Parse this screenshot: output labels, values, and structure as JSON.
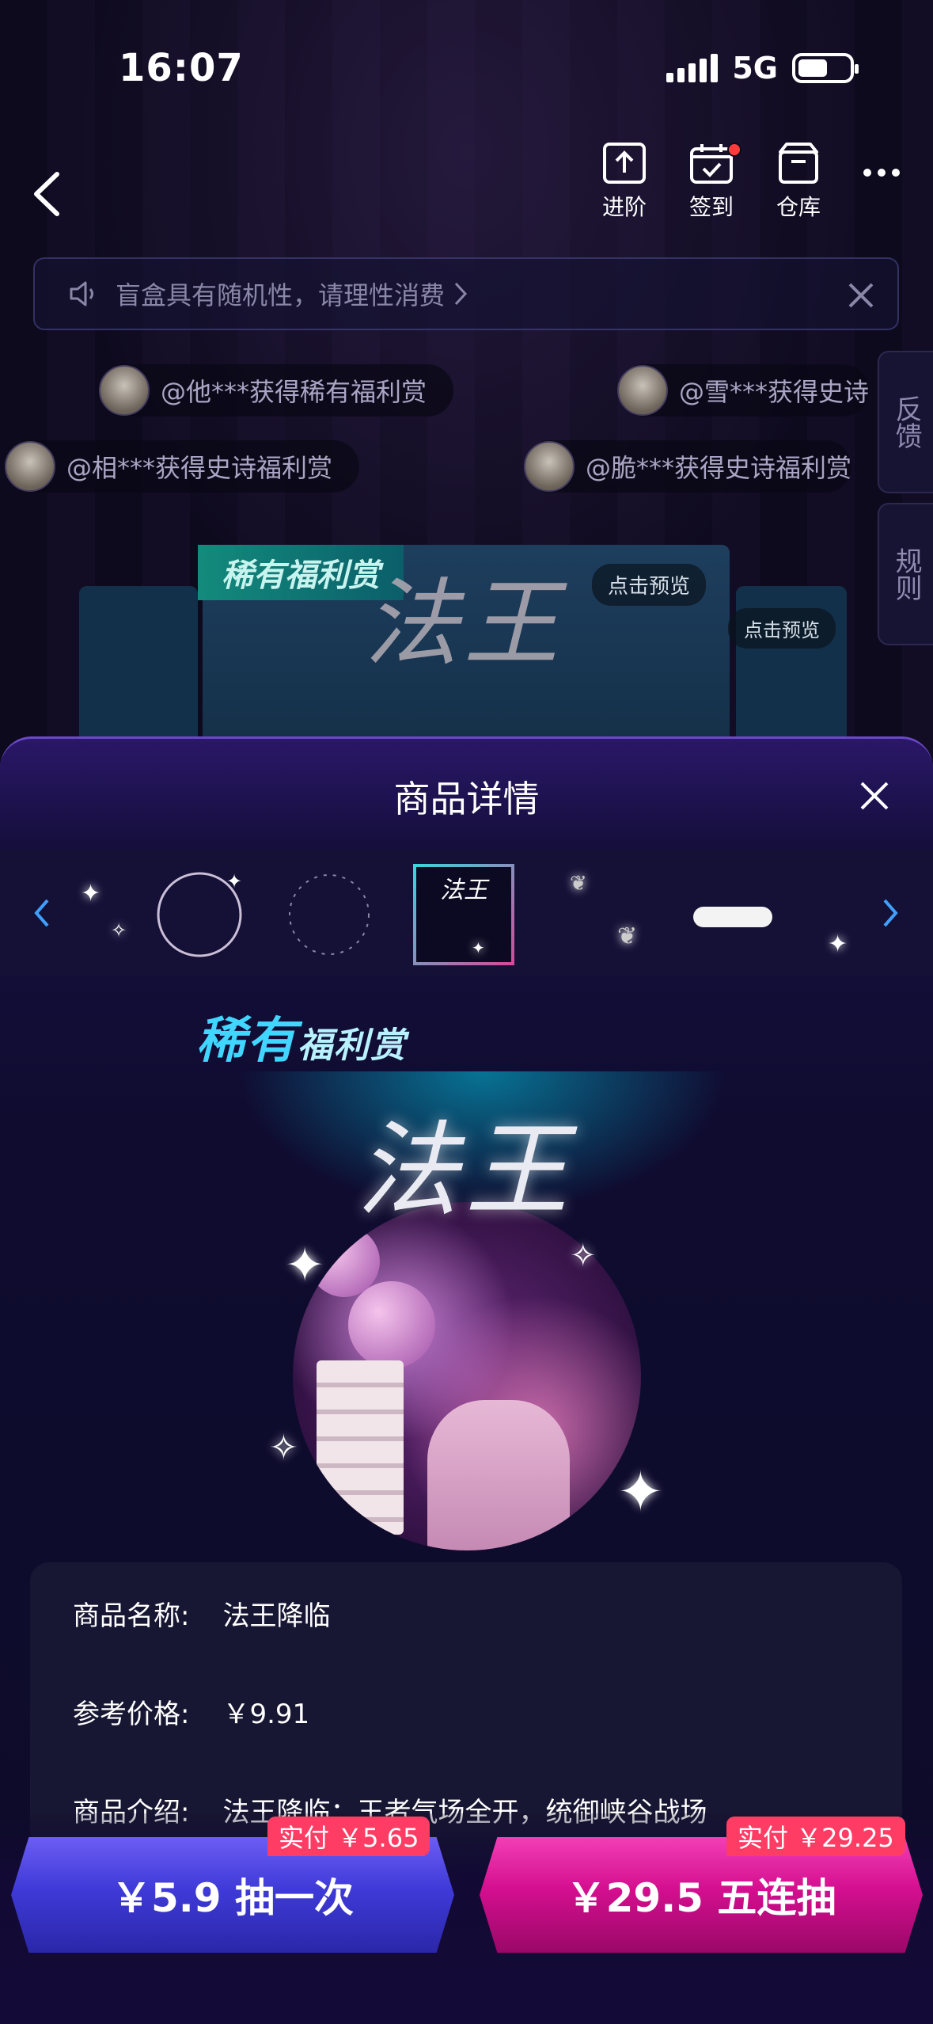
{
  "status_bar": {
    "time": "16:07",
    "network": "5G"
  },
  "nav": {
    "actions": [
      {
        "label": "进阶",
        "icon": "upload-icon"
      },
      {
        "label": "签到",
        "icon": "calendar-check-icon"
      },
      {
        "label": "仓库",
        "icon": "box-icon"
      }
    ]
  },
  "notice": {
    "text": "盲盒具有随机性，请理性消费"
  },
  "winners": [
    "@他***获得稀有福利赏",
    "@雪***获得史诗",
    "@相***获得史诗福利赏",
    "@脆***获得史诗福利赏"
  ],
  "side_tabs": {
    "feedback": "反馈",
    "rules": "规则"
  },
  "background_cards": {
    "rare_label": "稀有福利赏",
    "title": "法王",
    "preview_label": "点击预览"
  },
  "sheet": {
    "title": "商品详情",
    "hero": {
      "banner_main": "稀有",
      "banner_sub": "福利赏",
      "title": "法王"
    },
    "selected_thumb_title": "法王",
    "info": {
      "name_key": "商品名称:",
      "name_value": "法王降临",
      "price_key": "参考价格:",
      "price_value": "￥9.91",
      "intro_key": "商品介绍:",
      "intro_value": "法王降临：王者气场全开，统御峡谷战场"
    }
  },
  "actions": {
    "single": {
      "label": "￥5.9 抽一次",
      "badge": "实付 ￥5.65"
    },
    "five": {
      "label": "￥29.5 五连抽",
      "badge": "实付 ￥29.25"
    }
  },
  "colors": {
    "single_button": "#3f3ad8",
    "five_button": "#d40f8f",
    "badge": "#ff3d64",
    "accent_cyan": "#40d6ff"
  }
}
